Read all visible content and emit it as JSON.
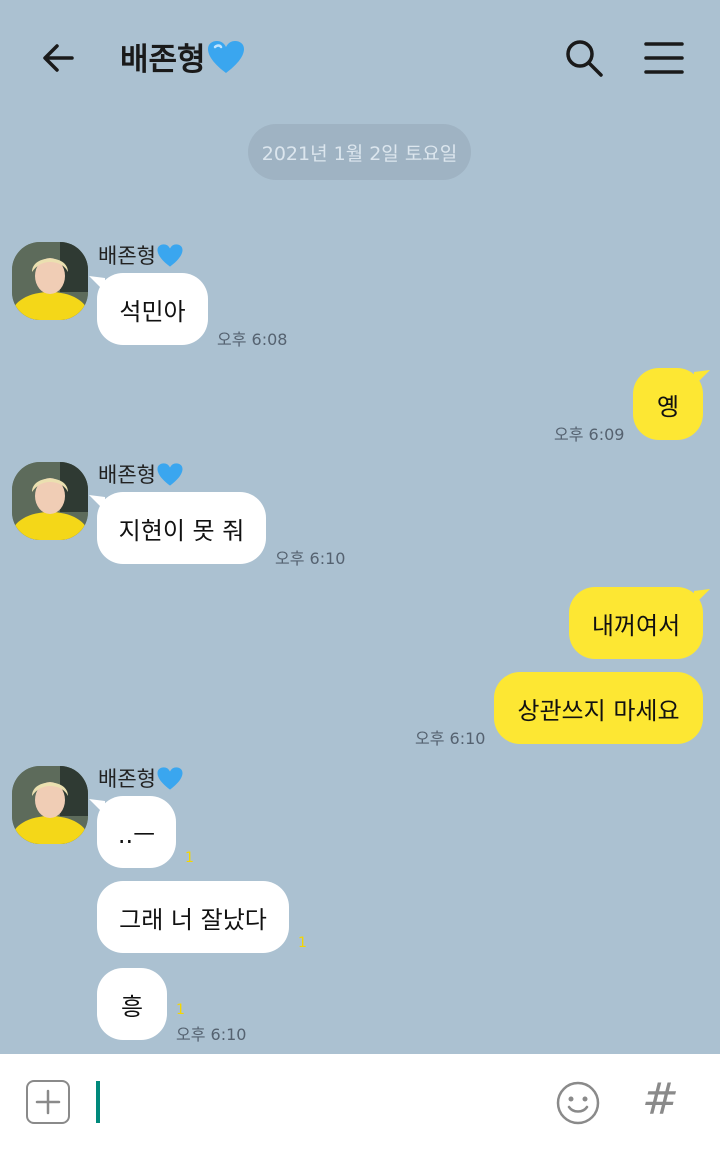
{
  "header": {
    "back_icon": "arrow-left-icon",
    "title": "배존형",
    "title_icon": "blue-heart-icon",
    "search_icon": "search-icon",
    "menu_icon": "hamburger-menu-icon"
  },
  "date_divider": "2021년 1월 2일 토요일",
  "messages": [
    {
      "sender": "배존형",
      "text": "석민아",
      "time": "오후 6:08",
      "direction": "in"
    },
    {
      "text": "옝",
      "time": "오후 6:09",
      "direction": "out"
    },
    {
      "sender": "배존형",
      "text": "지현이 못 줘",
      "time": "오후 6:10",
      "direction": "in"
    },
    {
      "text": "내꺼여서",
      "direction": "out"
    },
    {
      "text": "상관쓰지 마세요",
      "time": "오후 6:10",
      "direction": "out"
    },
    {
      "sender": "배존형",
      "text": "..ㅡ",
      "unread": "1",
      "direction": "in"
    },
    {
      "text": "그래 너 잘났다",
      "unread": "1",
      "direction": "in"
    },
    {
      "text": "흥",
      "unread": "1",
      "time": "오후 6:10",
      "direction": "in"
    }
  ],
  "input_bar": {
    "plus_icon": "plus-square-icon",
    "emoji_icon": "smiley-icon",
    "hash_label": "#"
  },
  "colors": {
    "background": "#abc1d1",
    "incoming_bubble": "#ffffff",
    "outgoing_bubble": "#fde733",
    "unread_count": "#f5d600",
    "caret": "#00897b"
  }
}
